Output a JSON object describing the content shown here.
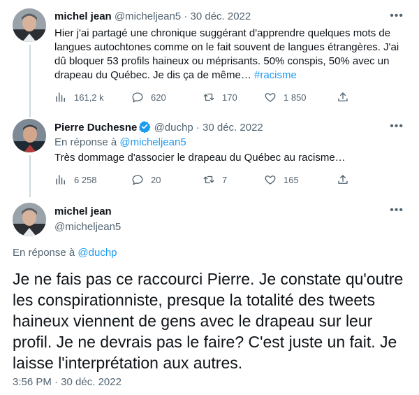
{
  "tweet1": {
    "name": "michel jean",
    "handle": "@micheljean5",
    "separator": "·",
    "date": "30 déc. 2022",
    "text": "Hier j'ai partagé une chronique suggérant d'apprendre quelques mots de langues autochtones comme on le fait souvent de langues étrangères. J'ai dû bloquer 53 profils haineux ou méprisants. 50% conspis, 50% avec un drapeau du Québec. Je dis ça de même… ",
    "hashtag": "#racisme",
    "views": "161,2 k",
    "replies": "620",
    "retweets": "170",
    "likes": "1 850"
  },
  "tweet2": {
    "name": "Pierre Duchesne",
    "handle": "@duchp",
    "separator": "·",
    "date": "30 déc. 2022",
    "reply_prefix": "En réponse à ",
    "reply_to": "@micheljean5",
    "text": "Très dommage d'associer le drapeau du Québec au racisme…",
    "views": "6 258",
    "replies": "20",
    "retweets": "7",
    "likes": "165"
  },
  "tweet3": {
    "name": "michel jean",
    "handle": "@micheljean5",
    "reply_prefix": "En réponse à ",
    "reply_to": "@duchp",
    "text": "Je ne fais pas ce raccourci Pierre. Je constate qu'outre les conspirationniste, presque la totalité des tweets haineux viennent de gens avec le drapeau sur leur profil. Je ne devrais pas le faire? C'est juste un fait. Je laisse l'interprétation aux autres.",
    "timestamp": "3:56 PM · 30 déc. 2022"
  },
  "icons": {
    "more": "more-icon",
    "views": "views-icon",
    "reply": "reply-icon",
    "retweet": "retweet-icon",
    "like": "heart-icon",
    "share": "share-icon",
    "verified": "verified-badge-icon"
  },
  "colors": {
    "link": "#1d9bf0",
    "muted": "#536471",
    "text": "#0f1419",
    "thread_line": "#cfd9de"
  }
}
